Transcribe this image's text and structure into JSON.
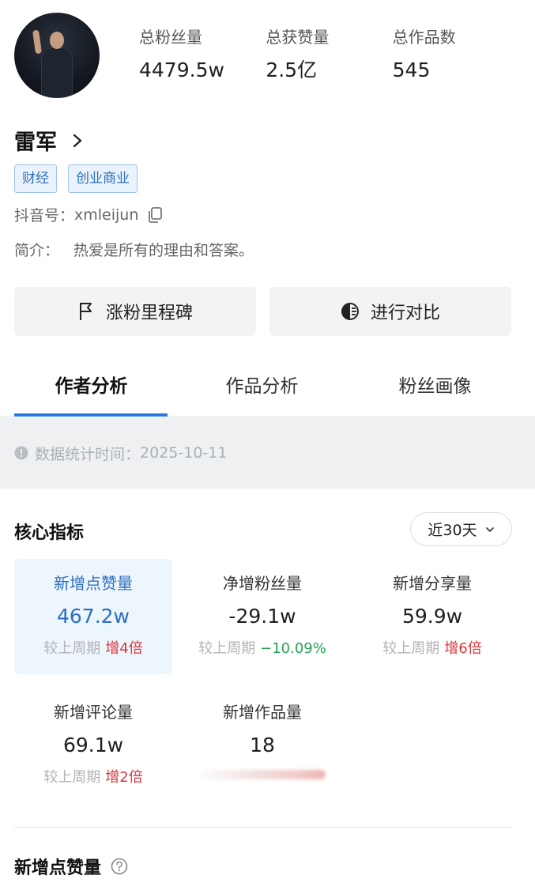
{
  "profile": {
    "name": "雷军",
    "tags": [
      "财经",
      "创业商业"
    ],
    "douyin_label": "抖音号：",
    "douyin_id": "xmleijun",
    "intro_label": "简介：",
    "intro_text": "热爱是所有的理由和答案。"
  },
  "stats": [
    {
      "label": "总粉丝量",
      "value": "4479.5w"
    },
    {
      "label": "总获赞量",
      "value": "2.5亿"
    },
    {
      "label": "总作品数",
      "value": "545"
    }
  ],
  "actions": {
    "milestone": "涨粉里程碑",
    "compare": "进行对比"
  },
  "tabs": [
    "作者分析",
    "作品分析",
    "粉丝画像"
  ],
  "notice": {
    "label": "数据统计时间：",
    "date": "2025-10-11"
  },
  "core": {
    "title": "核心指标",
    "period": "近30天",
    "metrics": [
      {
        "label": "新增点赞量",
        "value": "467.2w",
        "cmp_label": "较上周期",
        "cmp_value": "增4倍",
        "trend": "up"
      },
      {
        "label": "净增粉丝量",
        "value": "-29.1w",
        "cmp_label": "较上周期",
        "cmp_value": "−10.09%",
        "trend": "down"
      },
      {
        "label": "新增分享量",
        "value": "59.9w",
        "cmp_label": "较上周期",
        "cmp_value": "增6倍",
        "trend": "up"
      },
      {
        "label": "新增评论量",
        "value": "69.1w",
        "cmp_label": "较上周期",
        "cmp_value": "增2倍",
        "trend": "up"
      },
      {
        "label": "新增作品量",
        "value": "18"
      }
    ]
  },
  "section": {
    "title": "新增点赞量"
  },
  "colors": {
    "accent": "#2b78e4",
    "up": "#d9363e",
    "down": "#23a454",
    "tag_bg": "#eaf3fd"
  }
}
